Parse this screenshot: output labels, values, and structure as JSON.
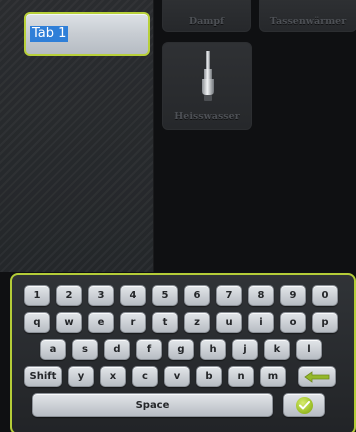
{
  "tab_name": {
    "value": "Tab 1"
  },
  "tiles": {
    "dampf": "Dampf",
    "tassenwaermer": "Tassenwärmer",
    "heisswasser": "Heisswasser"
  },
  "keyboard": {
    "row1": [
      "1",
      "2",
      "3",
      "4",
      "5",
      "6",
      "7",
      "8",
      "9",
      "0"
    ],
    "row2": [
      "q",
      "w",
      "e",
      "r",
      "t",
      "z",
      "u",
      "i",
      "o",
      "p"
    ],
    "row3": [
      "a",
      "s",
      "d",
      "f",
      "g",
      "h",
      "j",
      "k",
      "l"
    ],
    "row4": [
      "y",
      "x",
      "c",
      "v",
      "b",
      "n",
      "m"
    ],
    "shift_label": "Shift",
    "space_label": "Space",
    "backspace_icon": "arrow-left-icon",
    "confirm_icon": "check-icon"
  },
  "colors": {
    "accent": "#b4cc38",
    "selection": "#2f7fd8",
    "tile_label": "#4d5055"
  }
}
